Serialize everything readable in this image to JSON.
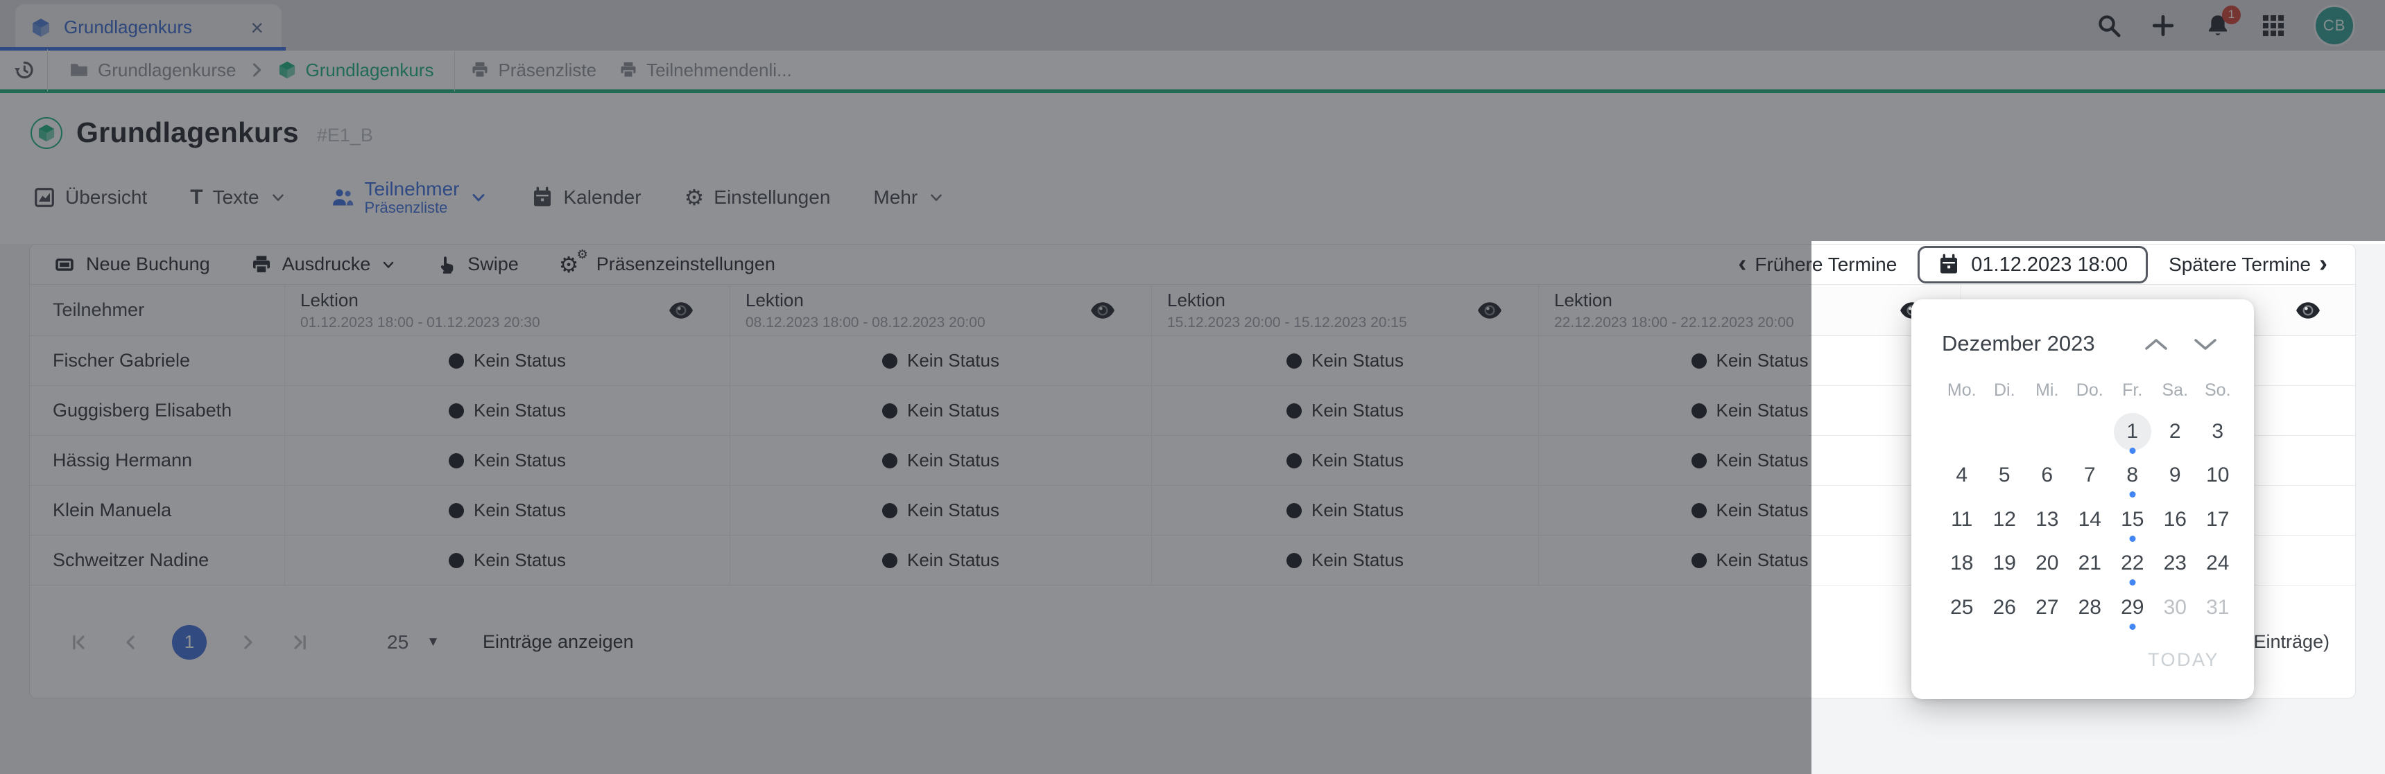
{
  "tab_bar": {
    "tab_title": "Grundlagenkurs",
    "close_glyph": "×",
    "notification_count": "1",
    "avatar_initials": "CB"
  },
  "breadcrumb": {
    "items": [
      {
        "label": "Grundlagenkurse"
      },
      {
        "label": "Grundlagenkurs"
      },
      {
        "label": "Präsenzliste"
      },
      {
        "label": "Teilnehmendenli..."
      }
    ]
  },
  "header": {
    "title": "Grundlagenkurs",
    "code": "#E1_B"
  },
  "nav": {
    "tabs": [
      {
        "label": "Übersicht"
      },
      {
        "label": "Texte"
      },
      {
        "label": "Teilnehmer",
        "sublabel": "Präsenzliste"
      },
      {
        "label": "Kalender"
      },
      {
        "label": "Einstellungen"
      },
      {
        "label": "Mehr"
      }
    ]
  },
  "toolbar": {
    "new_booking": "Neue Buchung",
    "printouts": "Ausdrucke",
    "swipe": "Swipe",
    "presence_settings": "Präsenzeinstellungen"
  },
  "date_nav": {
    "earlier": "Frühere Termine",
    "earlier_chev": "‹",
    "current": "01.12.2023 18:00",
    "later": "Spätere Termine",
    "later_chev": "›"
  },
  "table": {
    "participant_header": "Teilnehmer",
    "lesson_columns": [
      {
        "title": "Lektion",
        "range": "01.12.2023 18:00 - 01.12.2023 20:30"
      },
      {
        "title": "Lektion",
        "range": "08.12.2023 18:00 - 08.12.2023 20:00"
      },
      {
        "title": "Lektion",
        "range": "15.12.2023 20:00 - 15.12.2023 20:15"
      },
      {
        "title": "Lektion",
        "range": "22.12.2023 18:00 - 22.12.2023 20:00"
      },
      {
        "title": "",
        "range": ""
      }
    ],
    "rows": [
      {
        "name": "Fischer Gabriele",
        "statuses": [
          "Kein Status",
          "Kein Status",
          "Kein Status",
          "Kein Status"
        ]
      },
      {
        "name": "Guggisberg Elisabeth",
        "statuses": [
          "Kein Status",
          "Kein Status",
          "Kein Status",
          "Kein Status"
        ]
      },
      {
        "name": "Hässig Hermann",
        "statuses": [
          "Kein Status",
          "Kein Status",
          "Kein Status",
          "Kein Status"
        ]
      },
      {
        "name": "Klein Manuela",
        "statuses": [
          "Kein Status",
          "Kein Status",
          "Kein Status",
          "Kein Status"
        ]
      },
      {
        "name": "Schweitzer Nadine",
        "statuses": [
          "Kein Status",
          "Kein Status",
          "Kein Status",
          "Kein Status"
        ]
      }
    ]
  },
  "pagination": {
    "current_page": "1",
    "page_size": "25",
    "size_caret": "▼",
    "label": "Einträge anzeigen",
    "right_fragment": "Einträge)"
  },
  "calendar": {
    "month": "Dezember 2023",
    "weekdays": [
      "Mo.",
      "Di.",
      "Mi.",
      "Do.",
      "Fr.",
      "Sa.",
      "So."
    ],
    "weeks": [
      {
        "days": [
          "",
          "",
          "",
          "",
          "1",
          "2",
          "3"
        ]
      },
      {
        "days": [
          "4",
          "5",
          "6",
          "7",
          "8",
          "9",
          "10"
        ]
      },
      {
        "days": [
          "11",
          "12",
          "13",
          "14",
          "15",
          "16",
          "17"
        ]
      },
      {
        "days": [
          "18",
          "19",
          "20",
          "21",
          "22",
          "23",
          "24"
        ]
      },
      {
        "days": [
          "25",
          "26",
          "27",
          "28",
          "29",
          "30",
          "31"
        ]
      }
    ],
    "selected_day": "1",
    "dot_days": "1, 8, 15, 22, 29",
    "muted_days": "30, 31",
    "today_label": "TODAY"
  },
  "colors": {
    "accent_green": "#1DB380",
    "accent_blue": "#3B6FE0",
    "badge_red": "#CF4436",
    "avatar_teal": "#2F9E92",
    "dot_blue": "#4285F4"
  }
}
